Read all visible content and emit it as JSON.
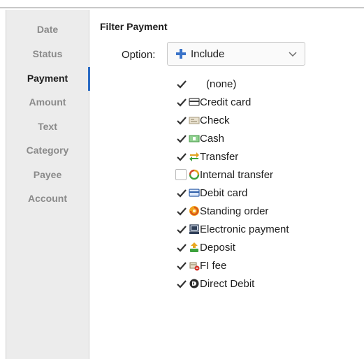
{
  "sidebar": {
    "items": [
      {
        "label": "Date",
        "active": false
      },
      {
        "label": "Status",
        "active": false
      },
      {
        "label": "Payment",
        "active": true
      },
      {
        "label": "Amount",
        "active": false
      },
      {
        "label": "Text",
        "active": false
      },
      {
        "label": "Category",
        "active": false
      },
      {
        "label": "Payee",
        "active": false
      },
      {
        "label": "Account",
        "active": false
      }
    ]
  },
  "filter": {
    "title": "Filter Payment",
    "option_label": "Option:",
    "option_value": "Include",
    "options": [
      {
        "label": "(none)",
        "checked": true,
        "icon": "none"
      },
      {
        "label": "Credit card",
        "checked": true,
        "icon": "credit-card-icon"
      },
      {
        "label": "Check",
        "checked": true,
        "icon": "check-icon"
      },
      {
        "label": "Cash",
        "checked": true,
        "icon": "cash-icon"
      },
      {
        "label": "Transfer",
        "checked": true,
        "icon": "transfer-icon"
      },
      {
        "label": "Internal transfer",
        "checked": false,
        "icon": "internal-transfer-icon"
      },
      {
        "label": "Debit card",
        "checked": true,
        "icon": "debit-card-icon"
      },
      {
        "label": "Standing order",
        "checked": true,
        "icon": "standing-order-icon"
      },
      {
        "label": "Electronic payment",
        "checked": true,
        "icon": "electronic-payment-icon"
      },
      {
        "label": "Deposit",
        "checked": true,
        "icon": "deposit-icon"
      },
      {
        "label": "FI fee",
        "checked": true,
        "icon": "fi-fee-icon"
      },
      {
        "label": "Direct Debit",
        "checked": true,
        "icon": "direct-debit-icon"
      }
    ]
  },
  "colors": {
    "accent": "#2b6cc4",
    "sidebar_bg": "#ececec",
    "inactive_text": "#8a8a8a"
  }
}
